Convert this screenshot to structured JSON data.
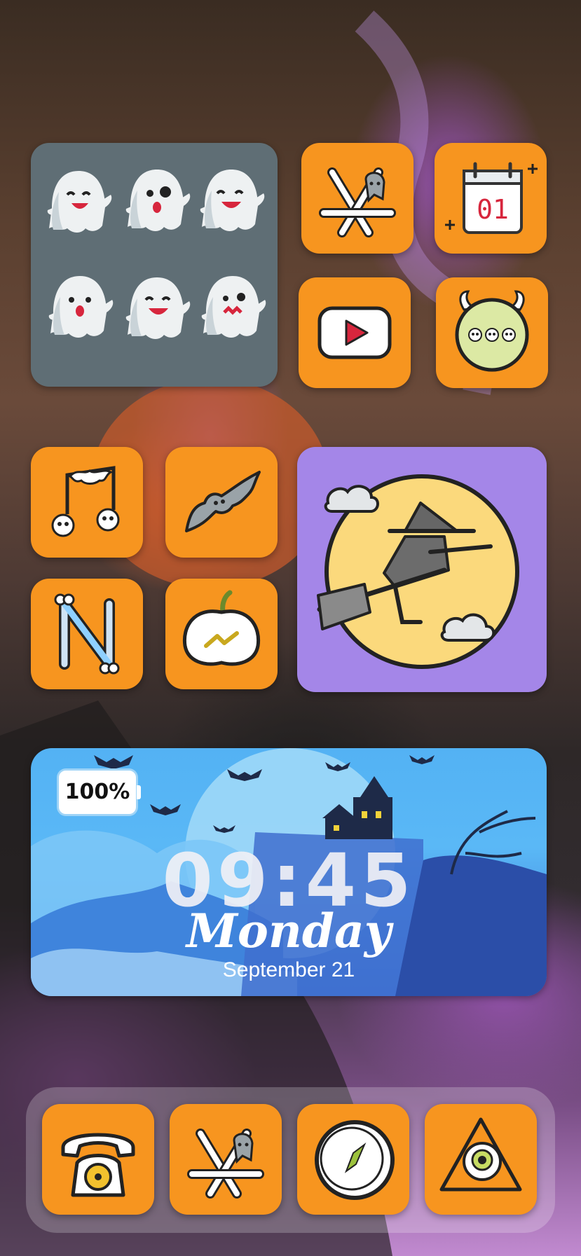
{
  "clock_widget": {
    "battery": "100%",
    "time": "09:45",
    "day": "Monday",
    "date": "September 21"
  },
  "icons": {
    "ghost_photo_widget": "ghost-emoji-grid",
    "row1_app1": "app-store-ghost-icon",
    "row1_app2": "calendar-icon",
    "calendar_day": "01",
    "row2_app1": "youtube-icon",
    "row2_app2": "monster-chat-icon",
    "row3_app1": "music-bat-icon",
    "row3_app2": "bat-icon",
    "row4_app1": "bone-n-icon",
    "row4_app2": "pumpkin-messenger-icon",
    "witch_widget": "witch-moon-icon",
    "dock": [
      "phone-icon",
      "app-store-ghost-icon",
      "compass-icon",
      "eye-pyramid-icon"
    ]
  },
  "colors": {
    "app_tile": "#f7951f",
    "ghost_widget": "#5f6e75",
    "witch_widget": "#a486e8",
    "clock_widget": "#53b2f4"
  }
}
